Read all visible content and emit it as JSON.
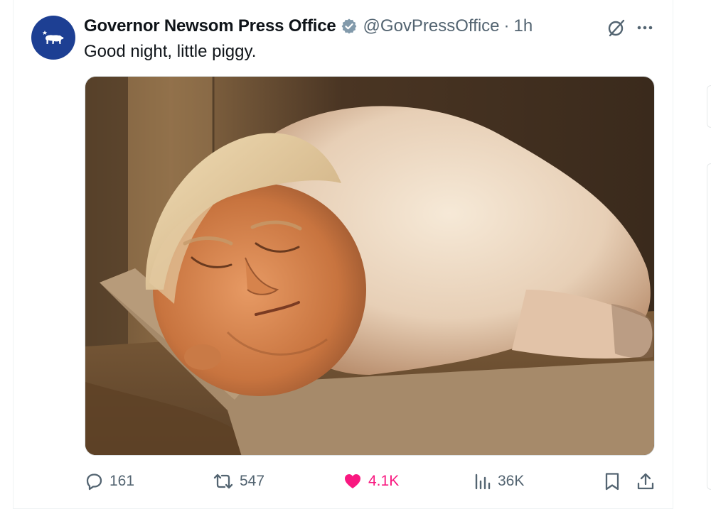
{
  "tweet": {
    "display_name": "Governor Newsom Press Office",
    "handle": "@GovPressOffice",
    "separator": "·",
    "time": "1h",
    "text": "Good night, little piggy.",
    "media_alt_icon": "photo-image",
    "verified_icon": "verified-badge-icon"
  },
  "actions": {
    "reply_count": "161",
    "retweet_count": "547",
    "like_count": "4.1K",
    "views_count": "36K"
  },
  "colors": {
    "avatar_bg": "#1d3f93",
    "like_pink": "#f91880",
    "text_primary": "#0f1419",
    "text_secondary": "#536471",
    "verified_gray": "#829aab"
  }
}
